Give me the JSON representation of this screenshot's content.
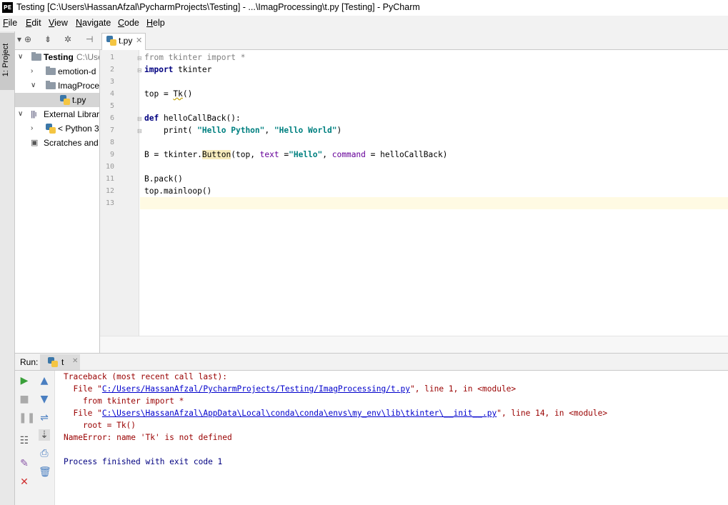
{
  "window": {
    "logo": "PE",
    "title": "Testing [C:\\Users\\HassanAfzal\\PycharmProjects\\Testing] - ...\\ImagProcessing\\t.py [Testing] - PyCharm"
  },
  "menu": [
    "File",
    "Edit",
    "View",
    "Navigate",
    "Code",
    "Help"
  ],
  "tool_window": {
    "project_label": "1: Project"
  },
  "project_tree": [
    {
      "label": "Testing",
      "suffix": "C:\\Use",
      "icon": "folder-icon",
      "expanded": true
    },
    {
      "label": "emotion-d",
      "icon": "folder-icon",
      "expanded": false
    },
    {
      "label": "ImagProce",
      "icon": "folder-icon",
      "expanded": true
    },
    {
      "label": "t.py",
      "icon": "python-file-icon",
      "selected": true
    },
    {
      "label": "External Librari",
      "icon": "library-icon",
      "expanded": true
    },
    {
      "label": "< Python 3",
      "icon": "python-icon",
      "expanded": false
    },
    {
      "label": "Scratches and (",
      "icon": "scratches-icon"
    }
  ],
  "editor": {
    "tab_label": "t.py",
    "current_line": 13,
    "line_numbers": [
      "1",
      "2",
      "3",
      "4",
      "5",
      "6",
      "7",
      "8",
      "9",
      "10",
      "11",
      "12",
      "13"
    ],
    "code": {
      "l1": "from tkinter import *",
      "l2_kw": "import",
      "l2_rest": " tkinter",
      "l4_a": "top = ",
      "l4_b": "Tk",
      "l4_c": "()",
      "l6_kw": "def",
      "l6_rest": " helloCallBack():",
      "l7_a": "    print( ",
      "l7_s1": "\"Hello Python\"",
      "l7_b": ", ",
      "l7_s2": "\"Hello World\"",
      "l7_c": ")",
      "l9_a": "B = tkinter.",
      "l9_b": "Button",
      "l9_c": "(top, ",
      "l9_p1": "text",
      "l9_d": " =",
      "l9_s": "\"Hello\"",
      "l9_e": ", ",
      "l9_p2": "command",
      "l9_f": " = helloCallBack)",
      "l11": "B.pack()",
      "l12": "top.mainloop()"
    }
  },
  "run": {
    "label": "Run:",
    "tab_label": "t",
    "console": {
      "c1": "Traceback (most recent call last):",
      "c2_a": "  File \"",
      "c2_link": "C:/Users/HassanAfzal/PycharmProjects/Testing/ImagProcessing/t.py",
      "c2_b": "\", line 1, in <module>",
      "c3": "    from tkinter import *",
      "c4_a": "  File \"",
      "c4_link": "C:\\Users\\HassanAfzal\\AppData\\Local\\conda\\conda\\envs\\my_env\\lib\\tkinter\\__init__.py",
      "c4_b": "\", line 14, in <module>",
      "c5": "    root = Tk()",
      "c6": "NameError: name 'Tk' is not defined",
      "c8": "Process finished with exit code 1"
    }
  }
}
